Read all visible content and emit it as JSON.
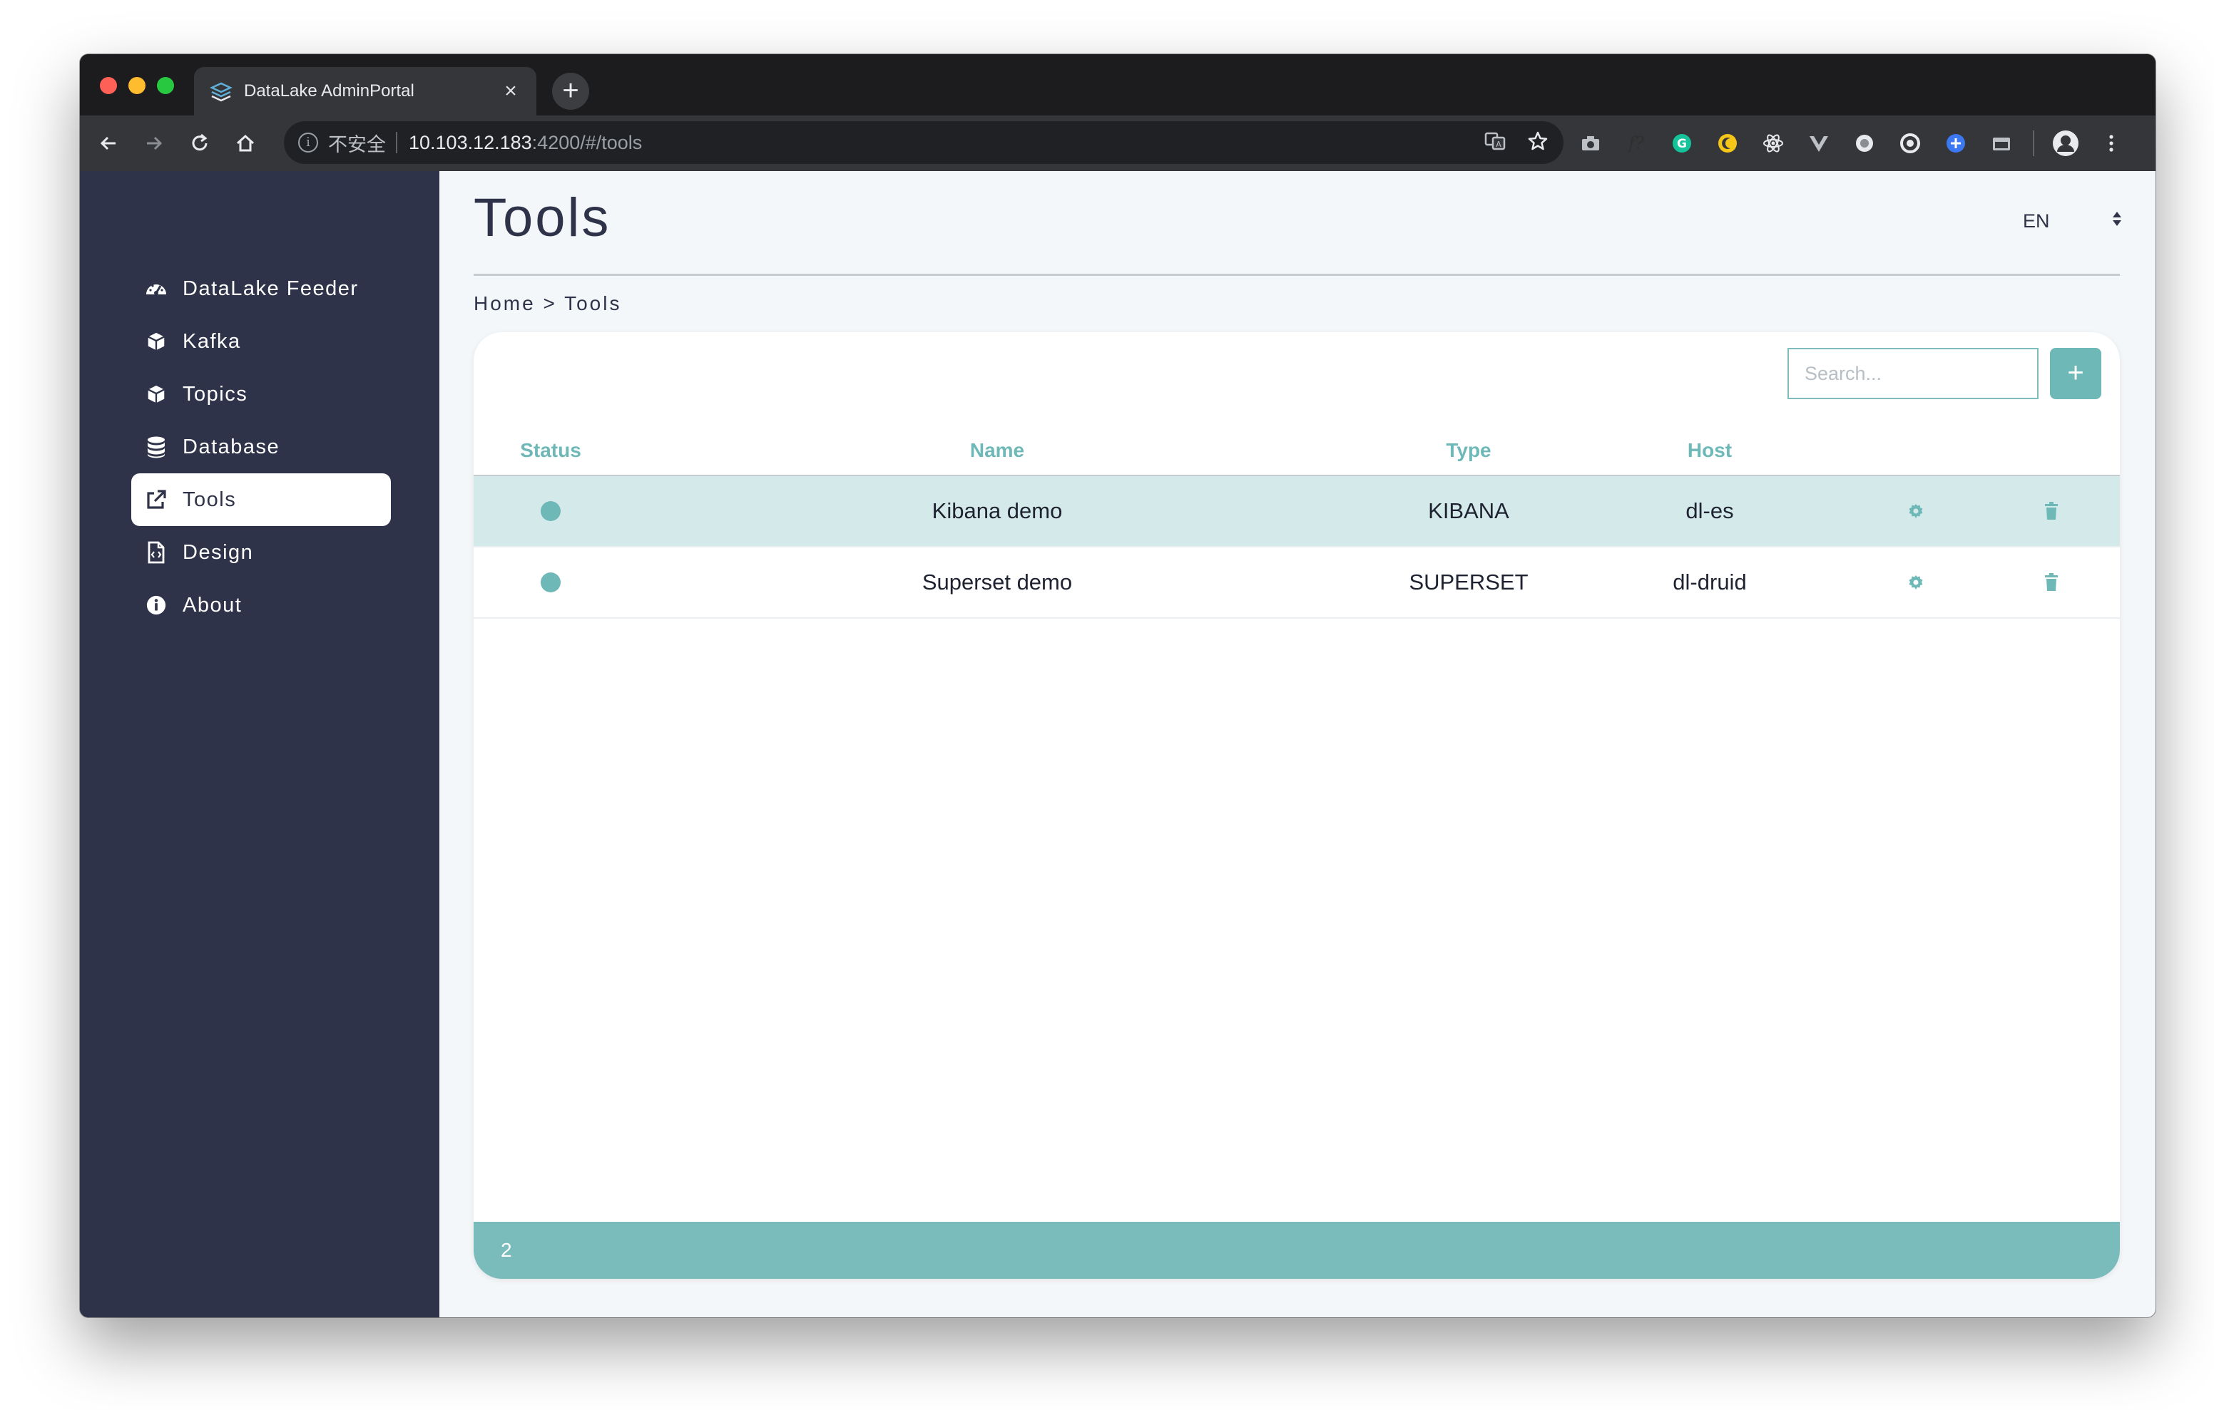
{
  "browser": {
    "tab_title": "DataLake AdminPortal",
    "tab_close": "×",
    "new_tab": "+",
    "address": {
      "security_label": "不安全",
      "url_host": "10.103.12.183",
      "url_rest": ":4200/#/tools"
    }
  },
  "sidebar": {
    "items": [
      {
        "label": "DataLake Feeder",
        "icon": "tachometer-icon"
      },
      {
        "label": "Kafka",
        "icon": "cube-icon"
      },
      {
        "label": "Topics",
        "icon": "cube-icon"
      },
      {
        "label": "Database",
        "icon": "database-icon"
      },
      {
        "label": "Tools",
        "icon": "external-link-icon",
        "active": true
      },
      {
        "label": "Design",
        "icon": "file-code-icon"
      },
      {
        "label": "About",
        "icon": "info-circle-icon"
      }
    ]
  },
  "header": {
    "title": "Tools",
    "language": "EN"
  },
  "breadcrumb": "Home > Tools",
  "toolbar": {
    "search_placeholder": "Search...",
    "add_label": "+"
  },
  "table": {
    "columns": [
      "Status",
      "Name",
      "Type",
      "Host"
    ],
    "rows": [
      {
        "status": "active",
        "name": "Kibana demo",
        "type": "KIBANA",
        "host": "dl-es"
      },
      {
        "status": "active",
        "name": "Superset demo",
        "type": "SUPERSET",
        "host": "dl-druid"
      }
    ],
    "footer_count": "2"
  },
  "colors": {
    "sidebar_bg": "#2f3349",
    "accent": "#6fb8b8",
    "row_highlight": "#d4eaea",
    "footer_bg": "#7abcbc"
  }
}
